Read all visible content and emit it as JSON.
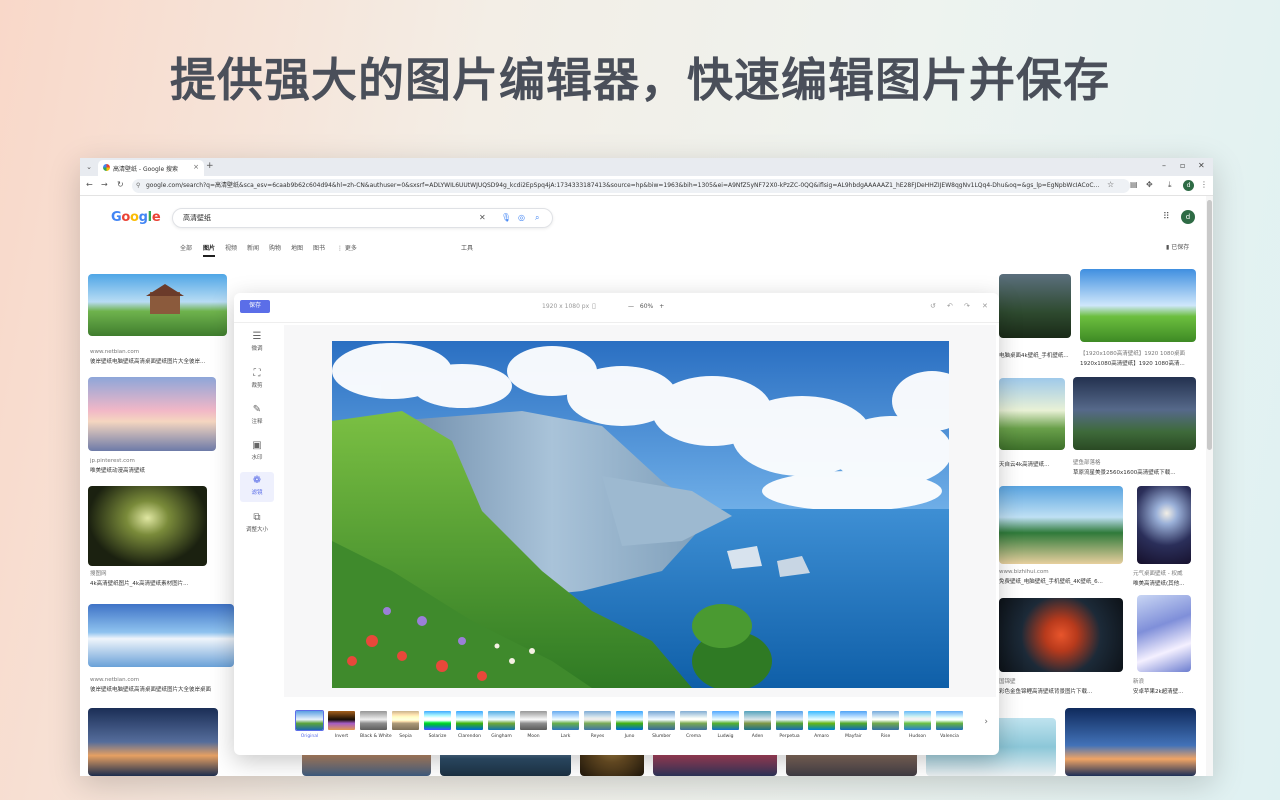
{
  "headline": "提供强大的图片编辑器，快速编辑图片并保存",
  "browser": {
    "tab_title": "高清壁纸 - Google 搜索",
    "tab_close": "×",
    "new_tab": "+",
    "url": "google.com/search?q=高清壁纸&sca_esv=6caab9b62c604d94&hl=zh-CN&authuser=0&sxsrf=ADLYWIL6UUtWJUQSD94g_kcdi2EpSpq4jA:1734333187413&source=hp&biw=1963&bih=1305&ei=A9NfZ5yNF72X0-kPzZC-0QQ&iflsig=AL9hbdgAAAAAZ1_hE28FJDeHHZIJEW8qgNv1LQq4-Dhu&oq=&gs_lp=EgNpbWcIACoC...",
    "profile_initial": "d"
  },
  "google": {
    "logo": [
      "G",
      "o",
      "o",
      "g",
      "l",
      "e"
    ],
    "query": "高清壁纸",
    "tabs": [
      "全部",
      "图片",
      "视频",
      "新闻",
      "购物",
      "地图",
      "图书",
      "⋮ 更多"
    ],
    "active_tab": "图片",
    "tools": "工具",
    "saved": "已保存",
    "avatar": "d",
    "results": [
      {
        "src": "www.netbian.com",
        "title": "彼岸壁纸电脑壁纸高清桌面壁纸图片大全彼岸..."
      },
      {
        "src": "jp.pinterest.com",
        "title": "唯美壁纸动漫高清壁纸"
      },
      {
        "src": "搜图网",
        "title": "4k高清壁纸图片_4k高清壁纸素材图片..."
      },
      {
        "src": "www.netbian.com",
        "title": "彼岸壁纸电脑壁纸高清桌面壁纸图片大全彼岸桌面"
      },
      {
        "src": "",
        "title": "电脑桌面4k壁纸_手机壁纸..."
      },
      {
        "src": "【1920x1080高清壁纸】1920 1080桌面",
        "title": "1920x1080高清壁纸】1920 1080高清..."
      },
      {
        "src": "",
        "title": "天自云4k高清壁纸..."
      },
      {
        "src": "壁鱼部落格",
        "title": "草原流星美景2560x1600高清壁纸下载..."
      },
      {
        "src": "www.bizhihui.com",
        "title": "免费壁纸_电脑壁纸_手机壁纸_4K壁纸_6..."
      },
      {
        "src": "元气桌面壁纸 - 权威",
        "title": "唯美高清壁纸(其他..."
      },
      {
        "src": "国锦壁",
        "title": "彩色金鱼锦鲤高清壁纸背景图片下载..."
      },
      {
        "src": "新浪",
        "title": "安卓苹果2k超清壁..."
      }
    ]
  },
  "editor": {
    "save": "保存",
    "dimensions": "1920 x 1080 px",
    "zoom": "60%",
    "zoom_minus": "—",
    "zoom_plus": "+",
    "tools": [
      {
        "icon": "☰",
        "label": "微调"
      },
      {
        "icon": "⛶",
        "label": "裁剪"
      },
      {
        "icon": "✎",
        "label": "注释"
      },
      {
        "icon": "▣",
        "label": "水印"
      },
      {
        "icon": "❁",
        "label": "滤镜"
      },
      {
        "icon": "⧉",
        "label": "调整大小"
      }
    ],
    "active_tool": "滤镜",
    "filters": [
      "Original",
      "Invert",
      "Black & White",
      "Sepia",
      "Solarize",
      "Clarendon",
      "Gingham",
      "Moon",
      "Lark",
      "Reyes",
      "Juno",
      "Slumber",
      "Crema",
      "Ludwig",
      "Aden",
      "Perpetua",
      "Amaro",
      "Mayfair",
      "Rise",
      "Hudson",
      "Valencia"
    ],
    "active_filter": "Original"
  },
  "colors": {
    "accent": "#5b6ee8",
    "headline": "#4a4f5a"
  }
}
